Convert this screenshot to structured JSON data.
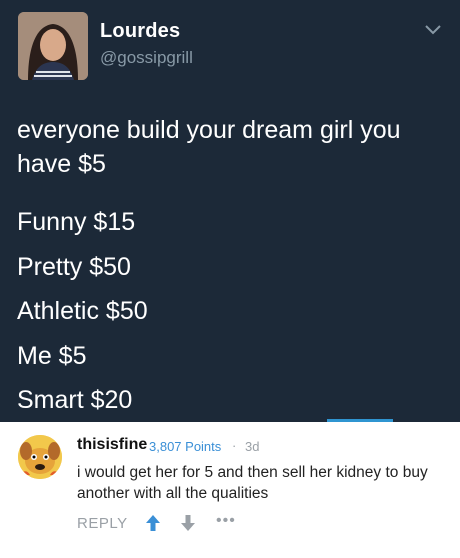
{
  "tweet": {
    "name": "Lourdes",
    "handle": "@gossipgrill",
    "text": "everyone build your dream girl you have $5",
    "items": [
      "Funny $15",
      "Pretty $50",
      "Athletic $50",
      "Me $5",
      "Smart $20"
    ],
    "background": "#1c2938"
  },
  "comment": {
    "username": "thisisfine",
    "points": "3,807 Points",
    "separator": "·",
    "time": "3d",
    "text": "i would get her for 5 and then sell her kidney to buy another with all the qualities",
    "reply_label": "REPLY",
    "more_label": "•••",
    "accent": "#3a8fd6"
  }
}
